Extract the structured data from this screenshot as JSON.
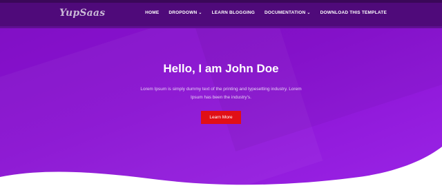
{
  "brand": {
    "logo_text": "YupSaas"
  },
  "nav": {
    "items": [
      {
        "label": "HOME",
        "has_caret": false
      },
      {
        "label": "DROPDOWN",
        "has_caret": true
      },
      {
        "label": "LEARN BLOGGING",
        "has_caret": false
      },
      {
        "label": "DOCUMENTATION",
        "has_caret": true
      },
      {
        "label": "DOWNLOAD THIS TEMPLATE",
        "has_caret": false
      }
    ]
  },
  "hero": {
    "title": "Hello, I am John Doe",
    "description": "Lorem Ipsum is simply dummy text of the printing and typesetting industry. Lorem Ipsum has been the industry's.",
    "button_label": "Learn More"
  },
  "colors": {
    "header_bg": "#4f0a7a",
    "hero_gradient_start": "#7f0fc2",
    "hero_gradient_end": "#9a24e6",
    "button_bg": "#e10f16"
  },
  "icons": {
    "caret": "chevron-down-icon"
  }
}
